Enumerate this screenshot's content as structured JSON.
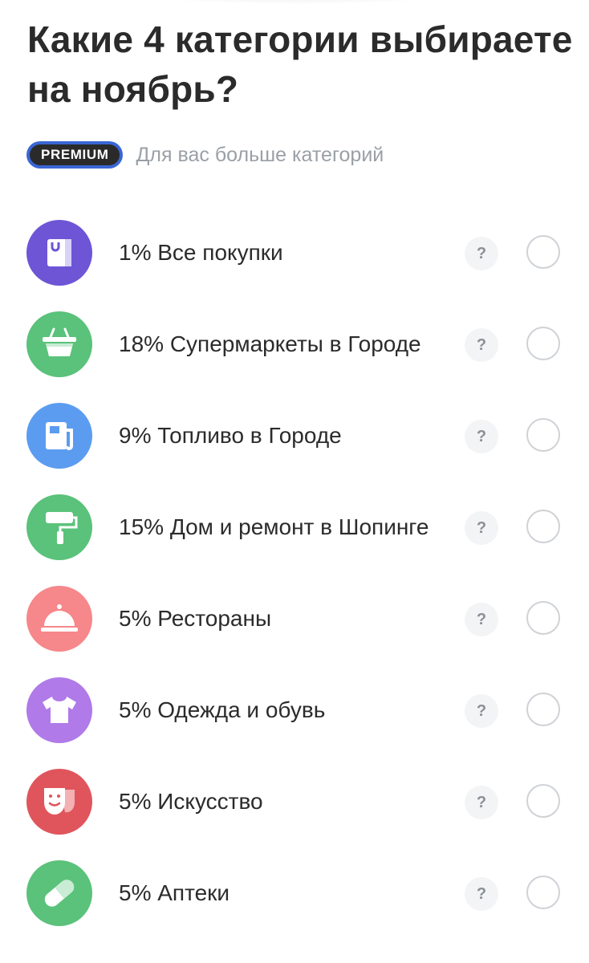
{
  "header": {
    "title": "Какие 4 категории выбираете на ноябрь?",
    "premium_badge": "PREMIUM",
    "premium_text": "Для вас больше категорий",
    "premium_color": "#3a66d4"
  },
  "categories": [
    {
      "label": "1% Все покупки",
      "icon": "shopping-bag-icon",
      "color": "#6e55d6"
    },
    {
      "label": "18% Супермаркеты в Городе",
      "icon": "basket-icon",
      "color": "#5ac27a"
    },
    {
      "label": "9% Топливо в Городе",
      "icon": "fuel-icon",
      "color": "#5b9cf0"
    },
    {
      "label": "15% Дом и ремонт в Шопинге",
      "icon": "paint-roller-icon",
      "color": "#5ac27a"
    },
    {
      "label": "5% Рестораны",
      "icon": "cloche-icon",
      "color": "#f6878a"
    },
    {
      "label": "5% Одежда и обувь",
      "icon": "tshirt-icon",
      "color": "#b07ae8"
    },
    {
      "label": "5% Искусство",
      "icon": "theater-mask-icon",
      "color": "#e0555c"
    },
    {
      "label": "5% Аптеки",
      "icon": "pill-icon",
      "color": "#5ac27a"
    }
  ],
  "help_label": "?"
}
